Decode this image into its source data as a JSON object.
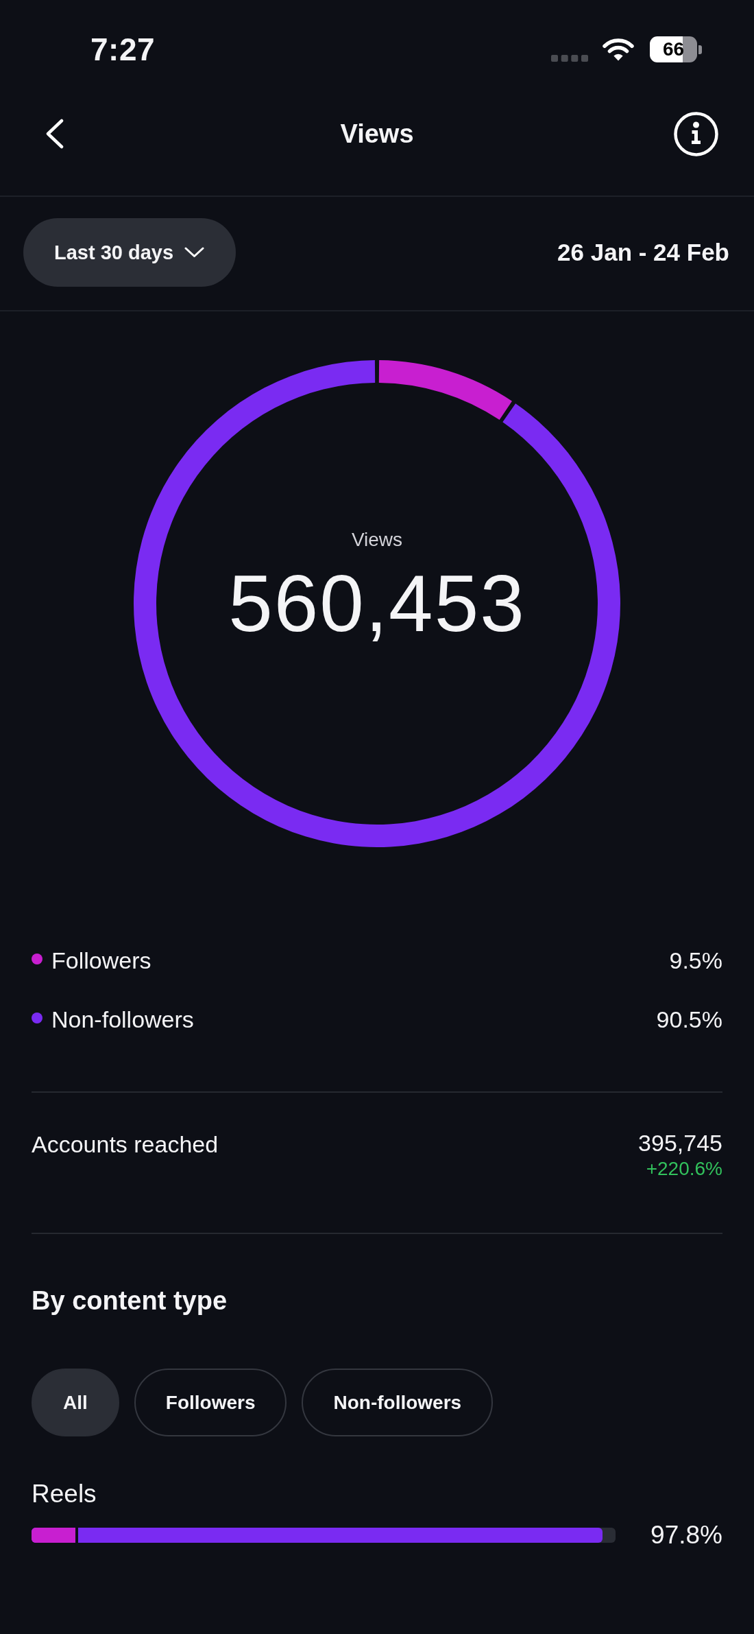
{
  "status_bar": {
    "time": "7:27",
    "battery": "66"
  },
  "header": {
    "title": "Views"
  },
  "filter": {
    "period": "Last 30 days",
    "date_range": "26 Jan - 24 Feb"
  },
  "views_chart": {
    "label": "Views",
    "total": "560,453",
    "chart_data": {
      "type": "donut",
      "values": [
        9.5,
        90.5
      ]
    }
  },
  "legend": [
    {
      "label": "Followers",
      "value": "9.5%",
      "color": "#c81fd0"
    },
    {
      "label": "Non-followers",
      "value": "90.5%",
      "color": "#7a2bf2"
    }
  ],
  "accounts_reached": {
    "label": "Accounts reached",
    "value": "395,745",
    "change": "+220.6%"
  },
  "content_type": {
    "title": "By content type",
    "filters": [
      {
        "label": "All",
        "selected": true
      },
      {
        "label": "Followers",
        "selected": false
      },
      {
        "label": "Non-followers",
        "selected": false
      }
    ],
    "rows": [
      {
        "label": "Reels",
        "value": "97.8%",
        "segments": [
          {
            "level": 0.978,
            "color": "#7a2bf2"
          },
          {
            "level": 0.08,
            "color": "#c81fd0"
          }
        ]
      }
    ]
  }
}
